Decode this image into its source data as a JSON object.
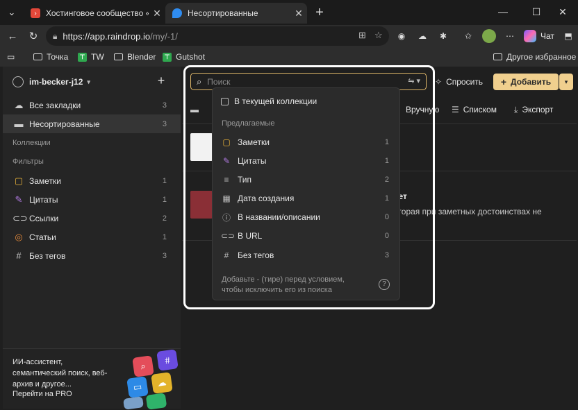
{
  "browser": {
    "tabs": [
      {
        "title": "Хостинговое сообщество «Timeweb»",
        "favicon_color": "#e4483a"
      },
      {
        "title": "Несортированные",
        "favicon_color": "#2f8cf0"
      }
    ],
    "url_host": "https://app.raindrop.io",
    "url_path": "/my/-1/",
    "chat_label": "Чат",
    "bookmarks": [
      "Точка",
      "TW",
      "Blender",
      "Gutshot"
    ],
    "other_favorites": "Другое избранное"
  },
  "sidebar": {
    "user": "im-becker-j12",
    "all_bookmarks": {
      "label": "Все закладки",
      "count": "3"
    },
    "unsorted": {
      "label": "Несортированные",
      "count": "3"
    },
    "collections_head": "Коллекции",
    "filters_head": "Фильтры",
    "filters": [
      {
        "label": "Заметки",
        "count": "1"
      },
      {
        "label": "Цитаты",
        "count": "1"
      },
      {
        "label": "Ссылки",
        "count": "2"
      },
      {
        "label": "Статьи",
        "count": "1"
      },
      {
        "label": "Без тегов",
        "count": "3"
      }
    ],
    "promo_text": "ИИ-ассистент, семантический поиск, веб-архив и другое...",
    "promo_link": "Перейти на PRO"
  },
  "toolbar": {
    "ask": "Спросить",
    "add": "Добавить",
    "manual": "Вручную",
    "list": "Списком",
    "export": "Экспорт"
  },
  "cards": {
    "card2_title": "лет",
    "card2_desc": "оторая при заметных достоинствах не"
  },
  "search": {
    "placeholder": "Поиск",
    "in_collection": "В текущей коллекции",
    "suggested_head": "Предлагаемые",
    "items": [
      {
        "label": "Заметки",
        "count": "1",
        "icon": "note-icon"
      },
      {
        "label": "Цитаты",
        "count": "1",
        "icon": "highlighter-icon"
      },
      {
        "label": "Тип",
        "count": "2",
        "icon": "type-icon"
      },
      {
        "label": "Дата создания",
        "count": "1",
        "icon": "calendar-icon"
      },
      {
        "label": "В названии/описании",
        "count": "0",
        "icon": "info-icon"
      },
      {
        "label": "В URL",
        "count": "0",
        "icon": "link-icon"
      },
      {
        "label": "Без тегов",
        "count": "3",
        "icon": "hash-icon"
      }
    ],
    "hint": "Добавьте - (тире) перед условием, чтобы исключить его из поиска"
  }
}
